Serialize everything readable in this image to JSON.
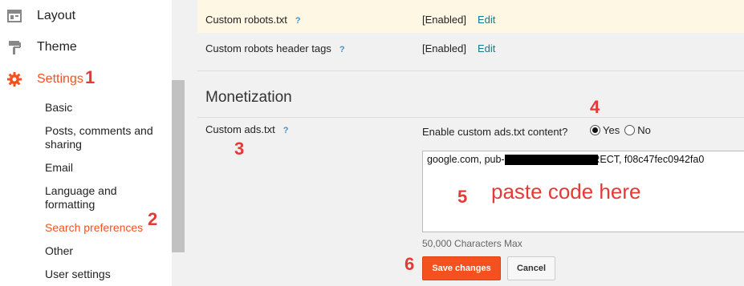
{
  "sidebar": {
    "layout_label": "Layout",
    "theme_label": "Theme",
    "settings_label": "Settings",
    "sub_items": [
      "Basic",
      "Posts, comments and sharing",
      "Email",
      "Language and formatting",
      "Search preferences",
      "Other",
      "User settings"
    ],
    "active_sub_item": "Search preferences"
  },
  "crawlers": {
    "robots_label": "Custom robots.txt",
    "robots_value": "[Enabled]",
    "header_tags_label": "Custom robots header tags",
    "header_tags_value": "[Enabled]",
    "edit_label": "Edit",
    "help_label": "?"
  },
  "monetization": {
    "title": "Monetization",
    "ads_label": "Custom ads.txt",
    "enable_question": "Enable custom ads.txt content?",
    "yes_label": "Yes",
    "no_label": "No",
    "selected": "Yes",
    "textarea_value": "google.com, pub-                          , DIRECT, f08c47fec0942fa0",
    "char_max": "50,000 Characters Max",
    "paste_note": "paste code here"
  },
  "buttons": {
    "save_label": "Save changes",
    "cancel_label": "Cancel"
  },
  "annotations": [
    "1",
    "2",
    "3",
    "4",
    "5",
    "6"
  ],
  "colors": {
    "accent": "#f4511e",
    "annotation": "#e53935",
    "link": "#1a7a8a",
    "highlight_row": "#fdf7e3"
  },
  "icons": [
    "layout-icon",
    "theme-roller-icon",
    "settings-gear-icon",
    "help-icon"
  ]
}
